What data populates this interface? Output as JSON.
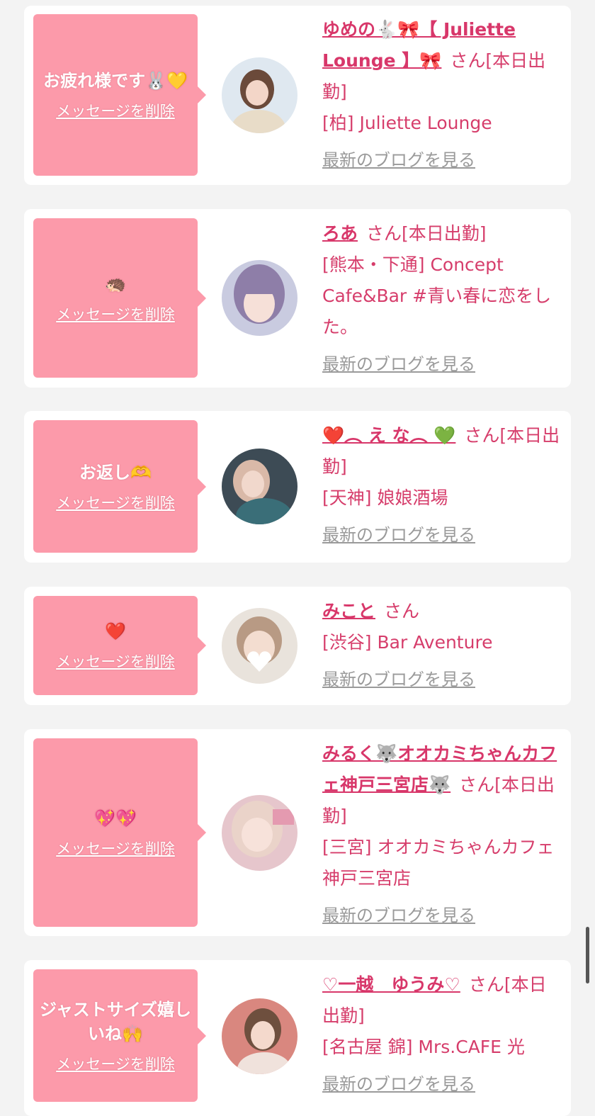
{
  "colors": {
    "bubble": "#fc9aaa",
    "name": "#d8376a",
    "text": "#d63d6b",
    "blog": "#9a9a9a"
  },
  "delete_label": "メッセージを削除",
  "blog_label": "最新のブログを見る",
  "san_label": "さん",
  "items": [
    {
      "message": "お疲れ様です🐰💛",
      "name": "ゆめの🐇🎀【 Juliette Lounge 】🎀",
      "status": "[本日出勤]",
      "shop": "[柏] Juliette Lounge",
      "avatar_icon": "user-avatar-photo"
    },
    {
      "message": "🦔",
      "name": "ろあ",
      "status": "[本日出勤]",
      "shop": "[熊本・下通] Concept Cafe&Bar #青い春に恋をした。",
      "avatar_icon": "user-avatar-photo"
    },
    {
      "message": "お返し🫶",
      "name": "❤️︵ え な︵ 💚",
      "status": "[本日出勤]",
      "shop": "[天神] 娘娘酒場",
      "avatar_icon": "user-avatar-photo"
    },
    {
      "message": "❤️",
      "name": "みこと",
      "status": "",
      "shop": "[渋谷] Bar Aventure",
      "avatar_icon": "user-avatar-photo"
    },
    {
      "message": "💖💖",
      "name": "みるく🐺オオカミちゃんカフェ神戸三宮店🐺",
      "status": "[本日出勤]",
      "shop": "[三宮] オオカミちゃんカフェ神戸三宮店",
      "avatar_icon": "user-avatar-photo"
    },
    {
      "message": "ジャストサイズ嬉しいね🙌",
      "name": "♡一越　ゆうみ♡",
      "status": "[本日出勤]",
      "shop": "[名古屋 錦] Mrs.CAFE 光",
      "avatar_icon": "user-avatar-photo"
    }
  ]
}
